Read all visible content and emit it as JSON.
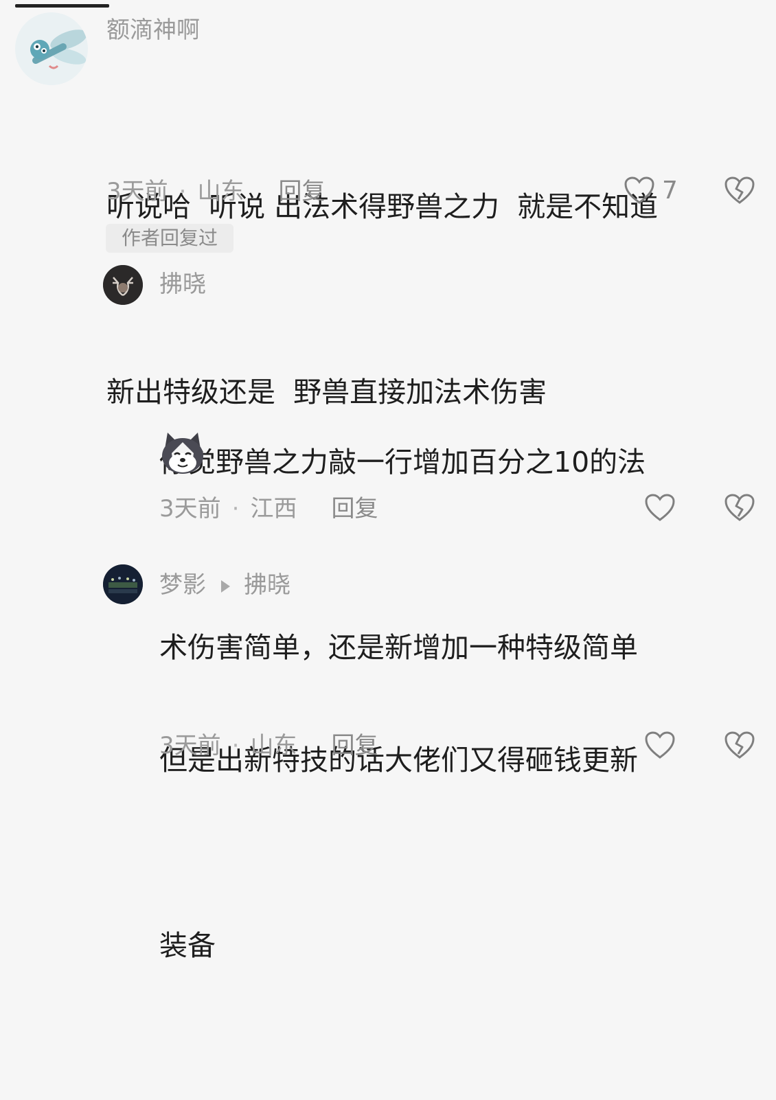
{
  "comments": [
    {
      "username": "额滴神啊",
      "lines": [
        "听说哈  听说 出法术得野兽之力  就是不知道",
        "新出特级还是  野兽直接加法术伤害"
      ],
      "time": "3天前",
      "location": "山东",
      "reply_label": "回复",
      "likes": "7"
    },
    {
      "author_badge": "作者回复过",
      "username": "拂晓",
      "lines": [
        "你觉野兽之力敲一行增加百分之10的法",
        "术伤害简单，还是新增加一种特级简单"
      ],
      "emoji": "husky-emoji",
      "time": "3天前",
      "location": "江西",
      "reply_label": "回复"
    },
    {
      "username": "梦影",
      "reply_to": "拂晓",
      "lines": [
        "但是出新特技的话大佬们又得砸钱更新",
        "装备"
      ],
      "time": "3天前",
      "location": "山东",
      "reply_label": "回复"
    }
  ],
  "colors": {
    "background": "#f6f6f6",
    "text": "#1e1e1e",
    "muted": "#9a9a9a",
    "badge_bg": "#ececec"
  }
}
